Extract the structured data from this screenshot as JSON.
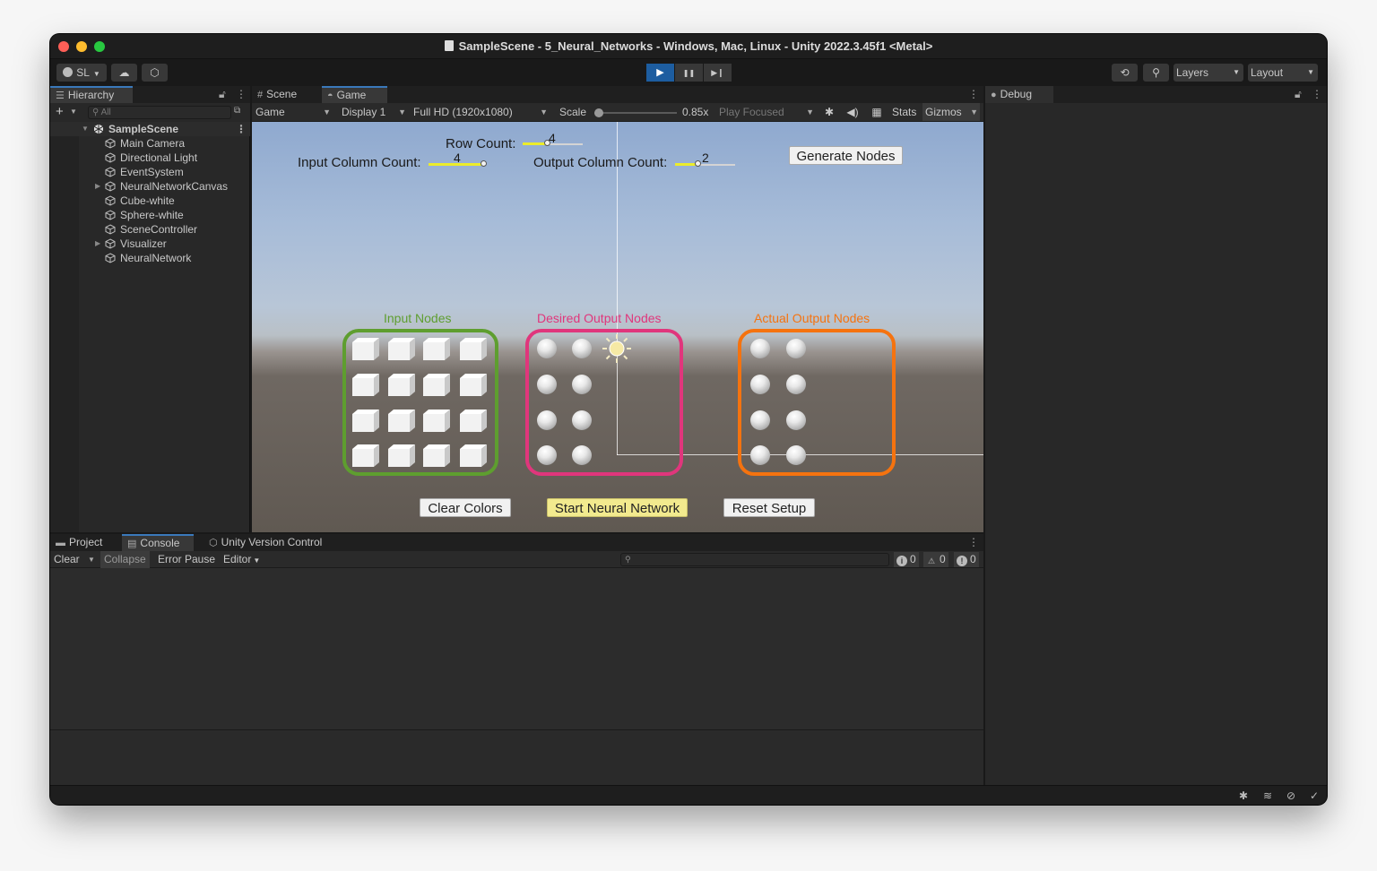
{
  "window": {
    "title": "SampleScene - 5_Neural_Networks - Windows, Mac, Linux - Unity 2022.3.45f1 <Metal>"
  },
  "toolbar": {
    "account_label": "SL",
    "layers_label": "Layers",
    "layout_label": "Layout",
    "play_icon": "▶",
    "pause_icon": "❚❚",
    "step_icon": "▶❙"
  },
  "hierarchy": {
    "tab_label": "Hierarchy",
    "search_placeholder": "All",
    "scene_name": "SampleScene",
    "items": [
      {
        "label": "Main Camera",
        "expandable": false
      },
      {
        "label": "Directional Light",
        "expandable": false
      },
      {
        "label": "EventSystem",
        "expandable": false
      },
      {
        "label": "NeuralNetworkCanvas",
        "expandable": true
      },
      {
        "label": "Cube-white",
        "expandable": false
      },
      {
        "label": "Sphere-white",
        "expandable": false
      },
      {
        "label": "SceneController",
        "expandable": false
      },
      {
        "label": "Visualizer",
        "expandable": true
      },
      {
        "label": "NeuralNetwork",
        "expandable": false
      }
    ]
  },
  "game_view": {
    "tabs": [
      {
        "label": "Scene",
        "icon": "#"
      },
      {
        "label": "Game",
        "icon": "⌨"
      }
    ],
    "game_dropdown": "Game",
    "display_dropdown": "Display 1",
    "resolution_dropdown": "Full HD (1920x1080)",
    "scale_label": "Scale",
    "scale_value": "0.85x",
    "play_focused_label": "Play Focused",
    "stats_label": "Stats",
    "gizmos_label": "Gizmos",
    "scene": {
      "row_count_label": "Row Count:",
      "row_count_value": "4",
      "input_column_label": "Input Column Count:",
      "input_column_value": "4",
      "output_column_label": "Output Column Count:",
      "output_column_value": "2",
      "generate_button": "Generate Nodes",
      "input_nodes_label": "Input Nodes",
      "desired_nodes_label": "Desired Output Nodes",
      "actual_nodes_label": "Actual Output Nodes",
      "clear_button": "Clear Colors",
      "start_button": "Start Neural Network",
      "reset_button": "Reset Setup",
      "colors": {
        "input": "#5e9e2f",
        "desired": "#e0367c",
        "actual": "#f5730f"
      }
    }
  },
  "console": {
    "tabs": [
      {
        "label": "Project",
        "icon": "folder-icon"
      },
      {
        "label": "Console",
        "icon": "console-icon"
      },
      {
        "label": "Unity Version Control",
        "icon": "version-control-icon"
      }
    ],
    "clear_label": "Clear",
    "collapse_label": "Collapse",
    "error_pause_label": "Error Pause",
    "editor_label": "Editor",
    "info_count": "0",
    "warning_count": "0",
    "error_count": "0"
  },
  "debug": {
    "tab_label": "Debug"
  }
}
